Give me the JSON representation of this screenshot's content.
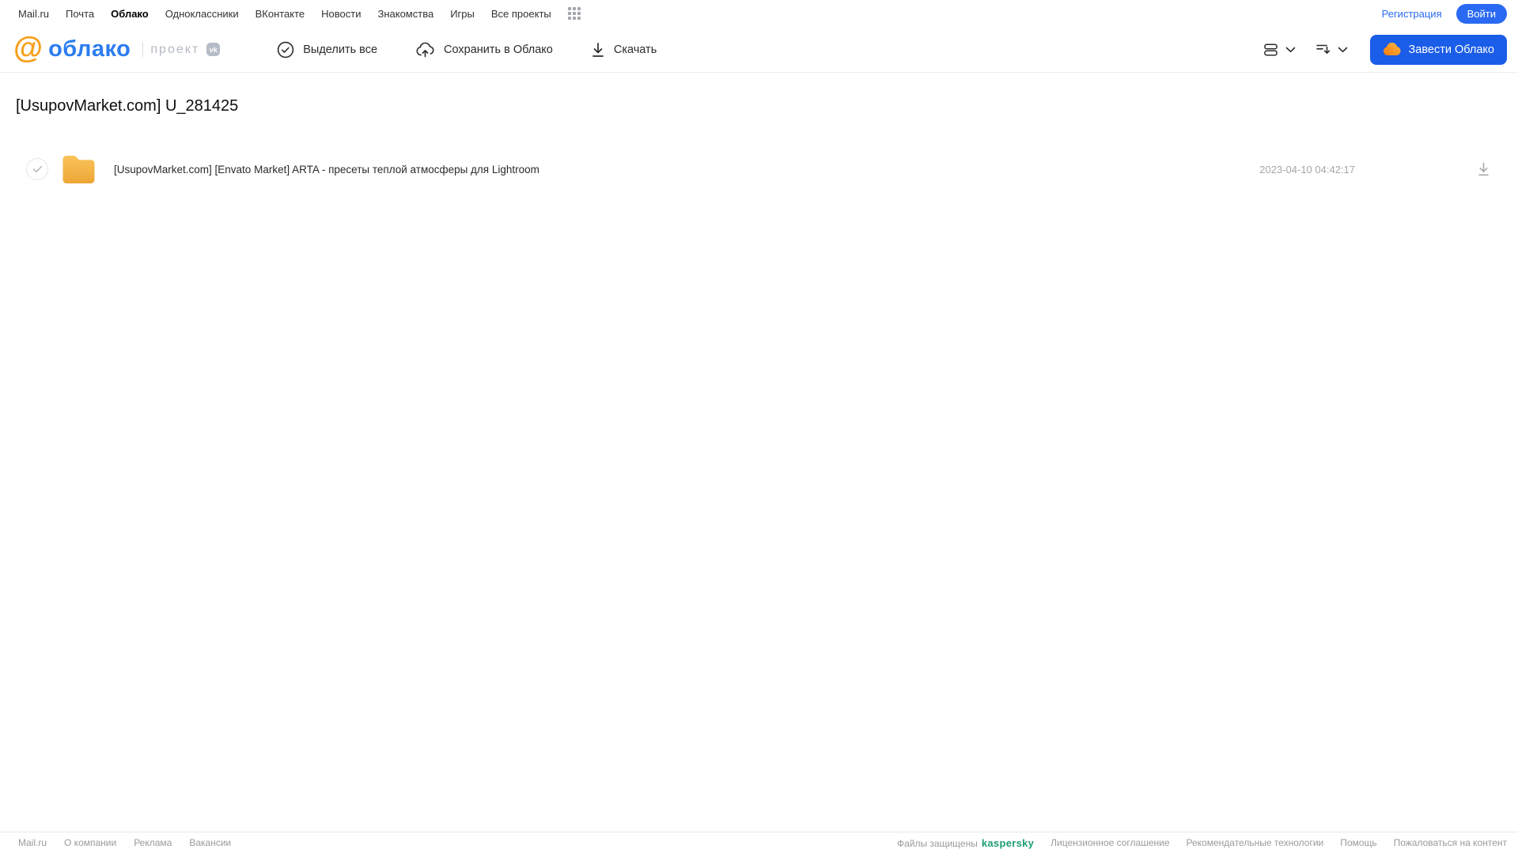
{
  "top_nav": {
    "items": [
      "Mail.ru",
      "Почта",
      "Облако",
      "Одноклассники",
      "ВКонтакте",
      "Новости",
      "Знакомства",
      "Игры",
      "Все проекты"
    ],
    "active_item": "Облако",
    "registration_label": "Регистрация",
    "login_label": "Войти"
  },
  "header": {
    "logo_text": "облако",
    "project_label": "проект",
    "vk_badge": "vk",
    "toolbar": {
      "select_all": "Выделить все",
      "save_to_cloud": "Сохранить в Облако",
      "download": "Скачать"
    },
    "cta_label": "Завести Облако"
  },
  "content": {
    "page_title": "[UsupovMarket.com] U_281425",
    "files": [
      {
        "type": "folder",
        "name": "[UsupovMarket.com] [Envato Market] ARTA - пресеты теплой атмосферы для Lightroom",
        "date": "2023-04-10 04:42:17"
      }
    ]
  },
  "footer": {
    "left_links": [
      "Mail.ru",
      "О компании",
      "Реклама",
      "Вакансии"
    ],
    "protected_text": "Файлы защищены",
    "kaspersky_label": "kaspersky",
    "right_links": [
      "Лицензионное соглашение",
      "Рекомендательные технологии",
      "Помощь",
      "Пожаловаться на контент"
    ]
  },
  "colors": {
    "accent_blue": "#2a6af2",
    "cta_blue": "#1a5de8",
    "logo_blue": "#2b7cf0",
    "logo_orange": "#f7a01d",
    "folder_yellow_top": "#f9c35b",
    "folder_yellow_bottom": "#eea636",
    "kaspersky_green": "#1d9e73"
  }
}
